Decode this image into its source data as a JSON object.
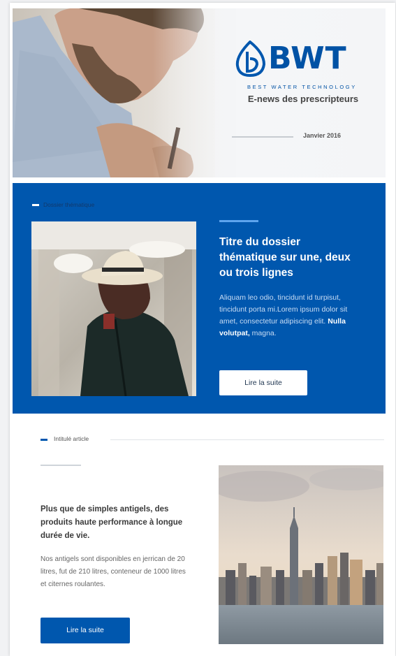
{
  "header": {
    "brand": "BWT",
    "brand_tagline": "BEST WATER TECHNOLOGY",
    "newsletter_title": "E-news des prescripteurs",
    "date": "Janvier 2016"
  },
  "feature": {
    "tag": "Dossier thématique",
    "title": "Titre du dossier thématique sur une, deux ou trois lignes",
    "body": "Aliquam leo odio, tincidunt id turpisut, tincidunt porta mi.Lorem ipsum dolor sit amet, consectetur adipiscing elit. ",
    "body_bold": "Nulla volutpat,",
    "body_end": " magna.",
    "button_label": "Lire la suite"
  },
  "article": {
    "tag": "Intitulé article",
    "title": "Plus que de simples antigels, des produits haute performance à longue durée de vie.",
    "body": "Nos antigels sont disponibles en jerrican de 20 litres, fut de 210 litres, conteneur de 1000 litres et citernes roulantes.",
    "button_label": "Lire la suite"
  },
  "colors": {
    "brand_blue": "#0057ae",
    "accent_light_blue": "#5ea4ee",
    "white": "#ffffff"
  },
  "icons": {
    "logo": "bwt-drop-logo"
  }
}
